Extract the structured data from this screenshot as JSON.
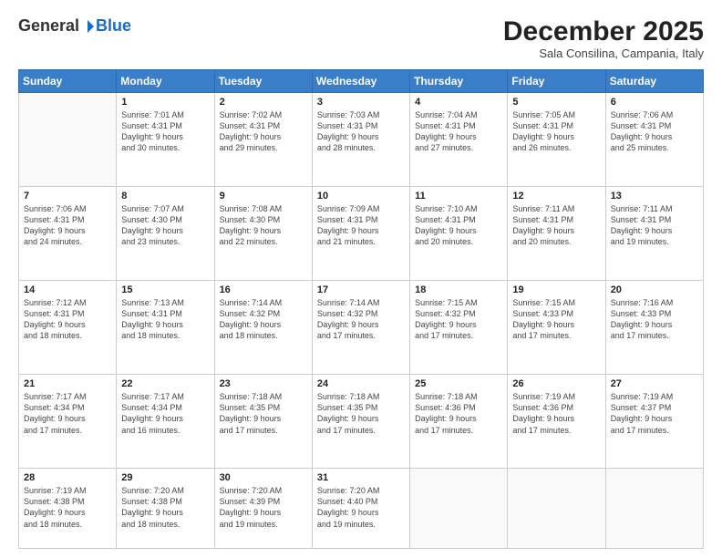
{
  "logo": {
    "general": "General",
    "blue": "Blue"
  },
  "header": {
    "month": "December 2025",
    "location": "Sala Consilina, Campania, Italy"
  },
  "weekdays": [
    "Sunday",
    "Monday",
    "Tuesday",
    "Wednesday",
    "Thursday",
    "Friday",
    "Saturday"
  ],
  "weeks": [
    [
      {
        "day": "",
        "info": ""
      },
      {
        "day": "1",
        "info": "Sunrise: 7:01 AM\nSunset: 4:31 PM\nDaylight: 9 hours\nand 30 minutes."
      },
      {
        "day": "2",
        "info": "Sunrise: 7:02 AM\nSunset: 4:31 PM\nDaylight: 9 hours\nand 29 minutes."
      },
      {
        "day": "3",
        "info": "Sunrise: 7:03 AM\nSunset: 4:31 PM\nDaylight: 9 hours\nand 28 minutes."
      },
      {
        "day": "4",
        "info": "Sunrise: 7:04 AM\nSunset: 4:31 PM\nDaylight: 9 hours\nand 27 minutes."
      },
      {
        "day": "5",
        "info": "Sunrise: 7:05 AM\nSunset: 4:31 PM\nDaylight: 9 hours\nand 26 minutes."
      },
      {
        "day": "6",
        "info": "Sunrise: 7:06 AM\nSunset: 4:31 PM\nDaylight: 9 hours\nand 25 minutes."
      }
    ],
    [
      {
        "day": "7",
        "info": "Sunrise: 7:06 AM\nSunset: 4:31 PM\nDaylight: 9 hours\nand 24 minutes."
      },
      {
        "day": "8",
        "info": "Sunrise: 7:07 AM\nSunset: 4:30 PM\nDaylight: 9 hours\nand 23 minutes."
      },
      {
        "day": "9",
        "info": "Sunrise: 7:08 AM\nSunset: 4:30 PM\nDaylight: 9 hours\nand 22 minutes."
      },
      {
        "day": "10",
        "info": "Sunrise: 7:09 AM\nSunset: 4:31 PM\nDaylight: 9 hours\nand 21 minutes."
      },
      {
        "day": "11",
        "info": "Sunrise: 7:10 AM\nSunset: 4:31 PM\nDaylight: 9 hours\nand 20 minutes."
      },
      {
        "day": "12",
        "info": "Sunrise: 7:11 AM\nSunset: 4:31 PM\nDaylight: 9 hours\nand 20 minutes."
      },
      {
        "day": "13",
        "info": "Sunrise: 7:11 AM\nSunset: 4:31 PM\nDaylight: 9 hours\nand 19 minutes."
      }
    ],
    [
      {
        "day": "14",
        "info": "Sunrise: 7:12 AM\nSunset: 4:31 PM\nDaylight: 9 hours\nand 18 minutes."
      },
      {
        "day": "15",
        "info": "Sunrise: 7:13 AM\nSunset: 4:31 PM\nDaylight: 9 hours\nand 18 minutes."
      },
      {
        "day": "16",
        "info": "Sunrise: 7:14 AM\nSunset: 4:32 PM\nDaylight: 9 hours\nand 18 minutes."
      },
      {
        "day": "17",
        "info": "Sunrise: 7:14 AM\nSunset: 4:32 PM\nDaylight: 9 hours\nand 17 minutes."
      },
      {
        "day": "18",
        "info": "Sunrise: 7:15 AM\nSunset: 4:32 PM\nDaylight: 9 hours\nand 17 minutes."
      },
      {
        "day": "19",
        "info": "Sunrise: 7:15 AM\nSunset: 4:33 PM\nDaylight: 9 hours\nand 17 minutes."
      },
      {
        "day": "20",
        "info": "Sunrise: 7:16 AM\nSunset: 4:33 PM\nDaylight: 9 hours\nand 17 minutes."
      }
    ],
    [
      {
        "day": "21",
        "info": "Sunrise: 7:17 AM\nSunset: 4:34 PM\nDaylight: 9 hours\nand 17 minutes."
      },
      {
        "day": "22",
        "info": "Sunrise: 7:17 AM\nSunset: 4:34 PM\nDaylight: 9 hours\nand 16 minutes."
      },
      {
        "day": "23",
        "info": "Sunrise: 7:18 AM\nSunset: 4:35 PM\nDaylight: 9 hours\nand 17 minutes."
      },
      {
        "day": "24",
        "info": "Sunrise: 7:18 AM\nSunset: 4:35 PM\nDaylight: 9 hours\nand 17 minutes."
      },
      {
        "day": "25",
        "info": "Sunrise: 7:18 AM\nSunset: 4:36 PM\nDaylight: 9 hours\nand 17 minutes."
      },
      {
        "day": "26",
        "info": "Sunrise: 7:19 AM\nSunset: 4:36 PM\nDaylight: 9 hours\nand 17 minutes."
      },
      {
        "day": "27",
        "info": "Sunrise: 7:19 AM\nSunset: 4:37 PM\nDaylight: 9 hours\nand 17 minutes."
      }
    ],
    [
      {
        "day": "28",
        "info": "Sunrise: 7:19 AM\nSunset: 4:38 PM\nDaylight: 9 hours\nand 18 minutes."
      },
      {
        "day": "29",
        "info": "Sunrise: 7:20 AM\nSunset: 4:38 PM\nDaylight: 9 hours\nand 18 minutes."
      },
      {
        "day": "30",
        "info": "Sunrise: 7:20 AM\nSunset: 4:39 PM\nDaylight: 9 hours\nand 19 minutes."
      },
      {
        "day": "31",
        "info": "Sunrise: 7:20 AM\nSunset: 4:40 PM\nDaylight: 9 hours\nand 19 minutes."
      },
      {
        "day": "",
        "info": ""
      },
      {
        "day": "",
        "info": ""
      },
      {
        "day": "",
        "info": ""
      }
    ]
  ]
}
